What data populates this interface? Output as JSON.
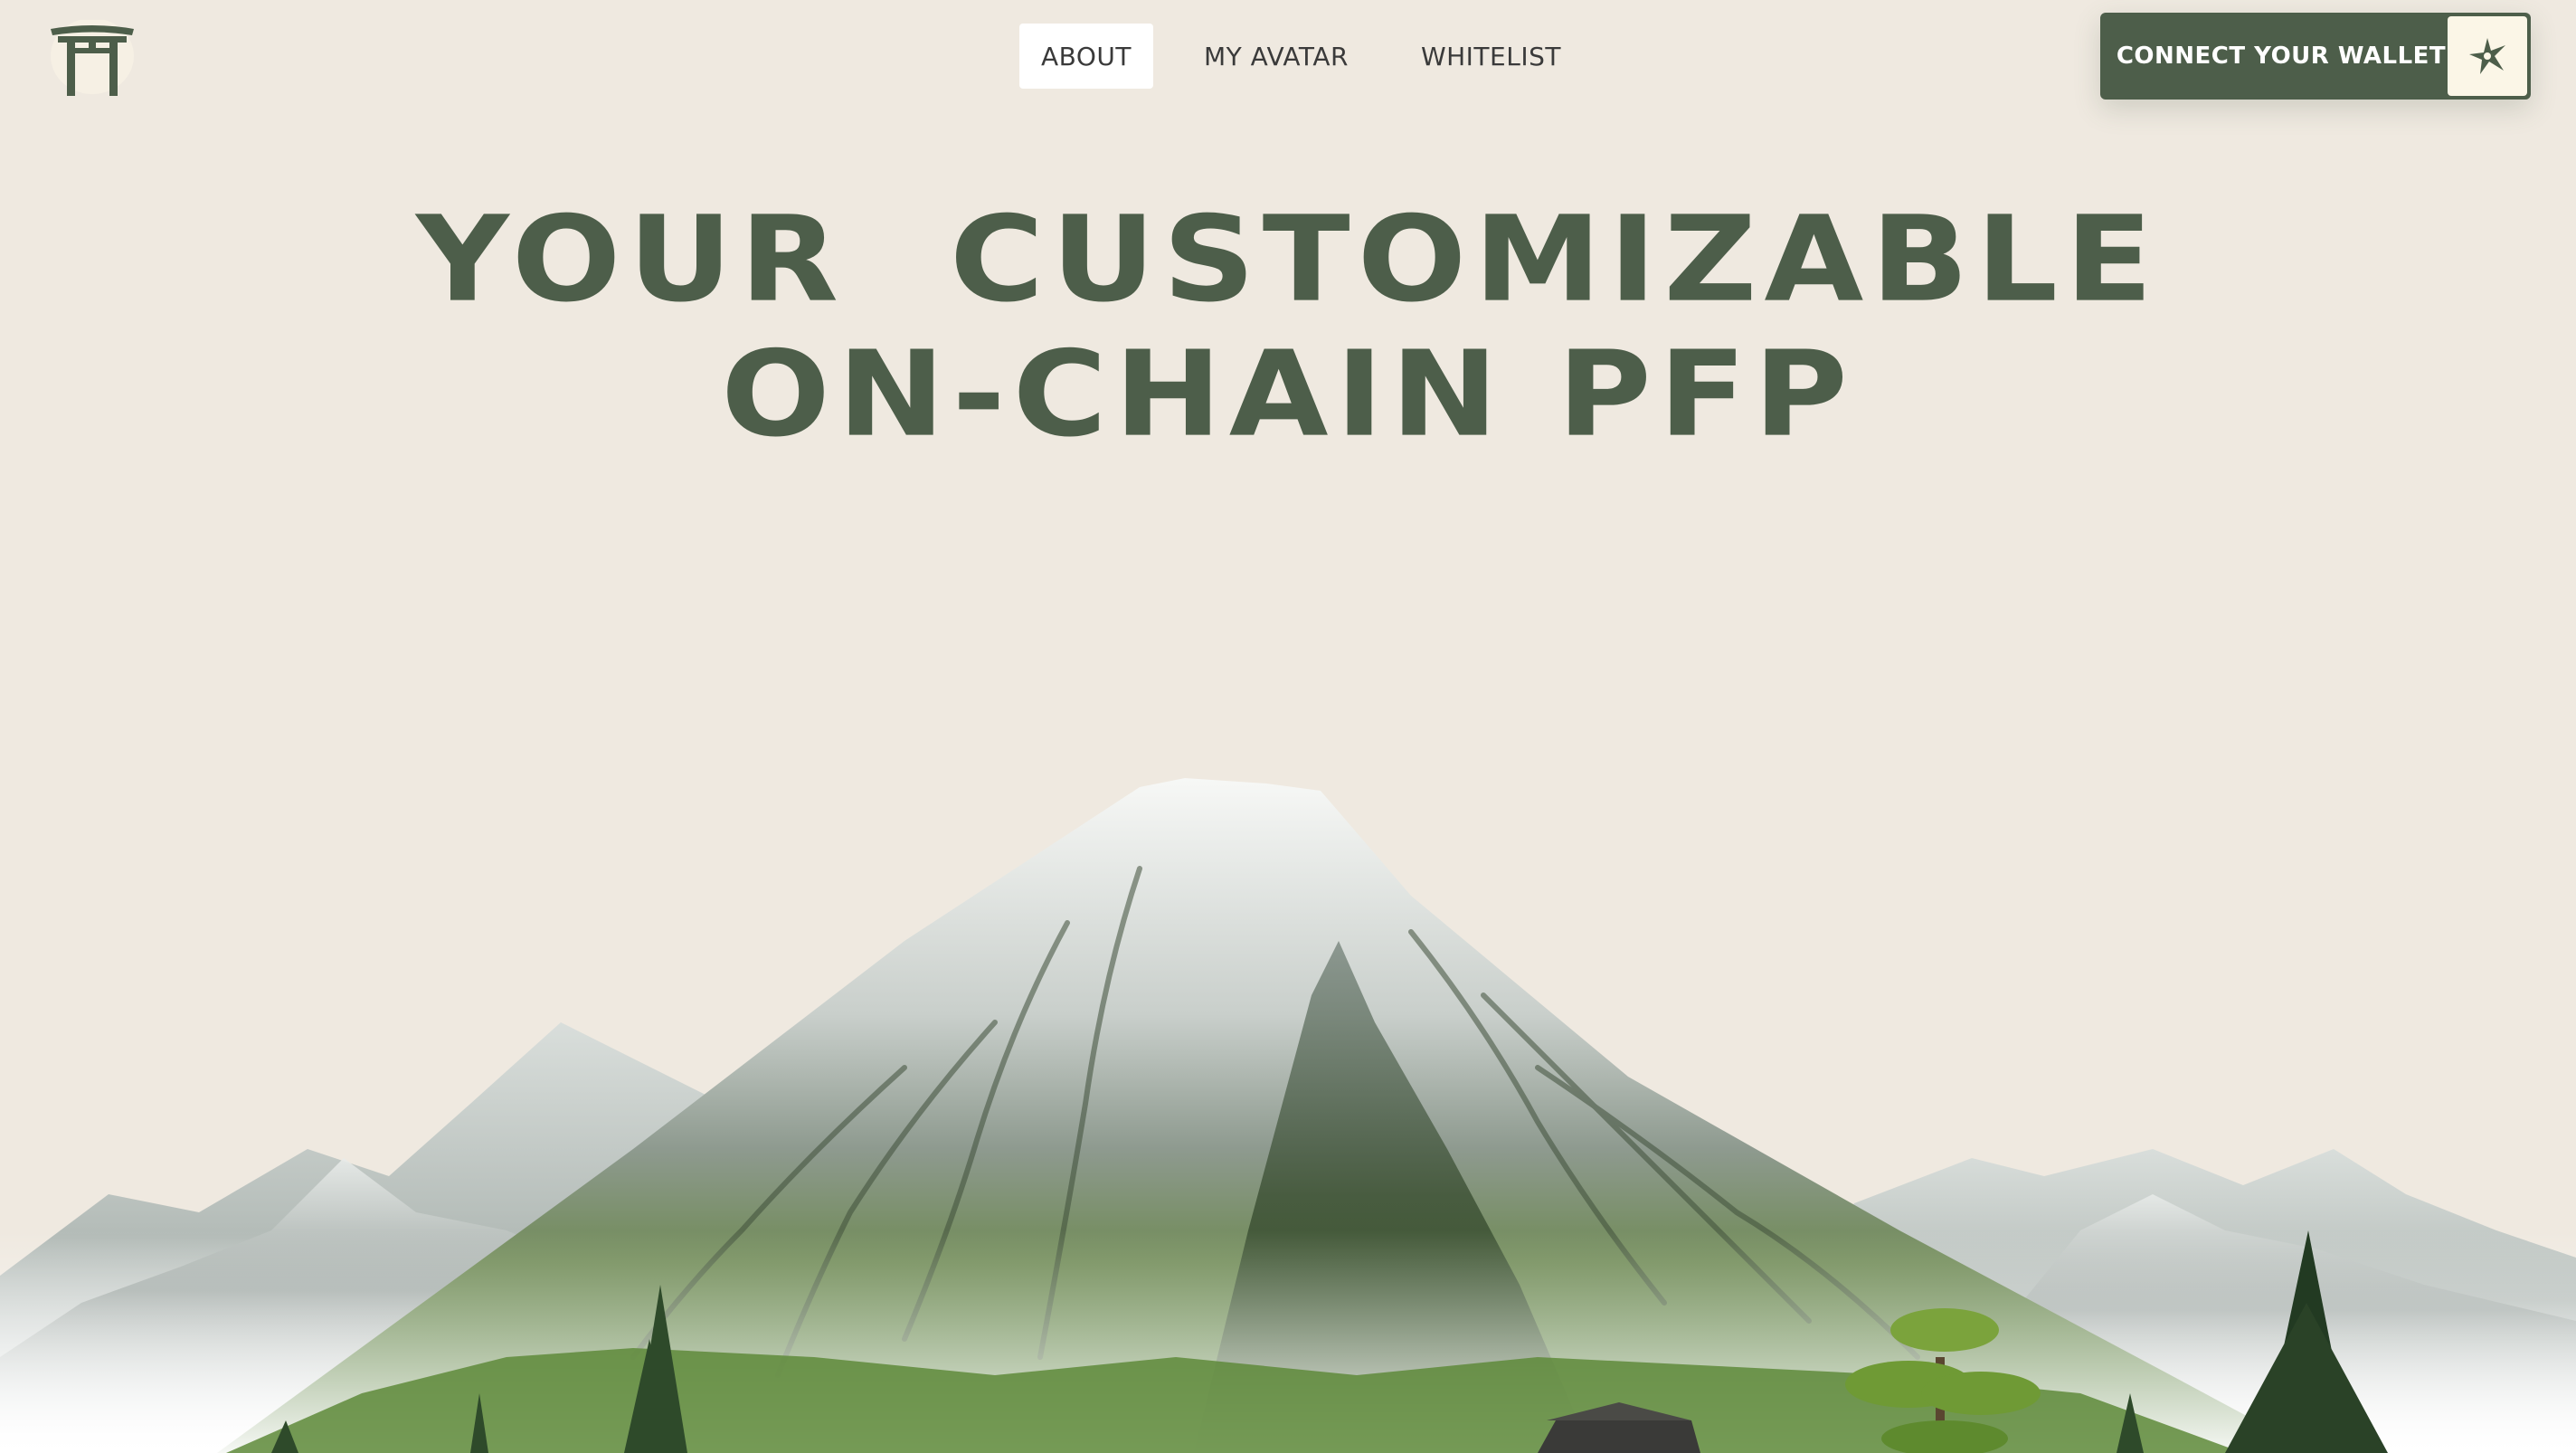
{
  "header": {
    "logo_icon": "torii-gate-icon",
    "nav": [
      {
        "label": "ABOUT",
        "active": true
      },
      {
        "label": "MY AVATAR",
        "active": false
      },
      {
        "label": "WHITELIST",
        "active": false
      }
    ],
    "wallet_button": {
      "label": "CONNECT YOUR WALLET",
      "icon": "shuriken-icon"
    }
  },
  "hero": {
    "title_line1": "YOUR  CUSTOMIZABLE",
    "title_line2": "ON-CHAIN PFP",
    "illustration": "mount-fuji-landscape"
  },
  "colors": {
    "background": "#EFE9E0",
    "primary": "#4D5E4A",
    "nav_active_bg": "#FFFFFF",
    "wallet_icon_bg": "#FBF6E7"
  }
}
